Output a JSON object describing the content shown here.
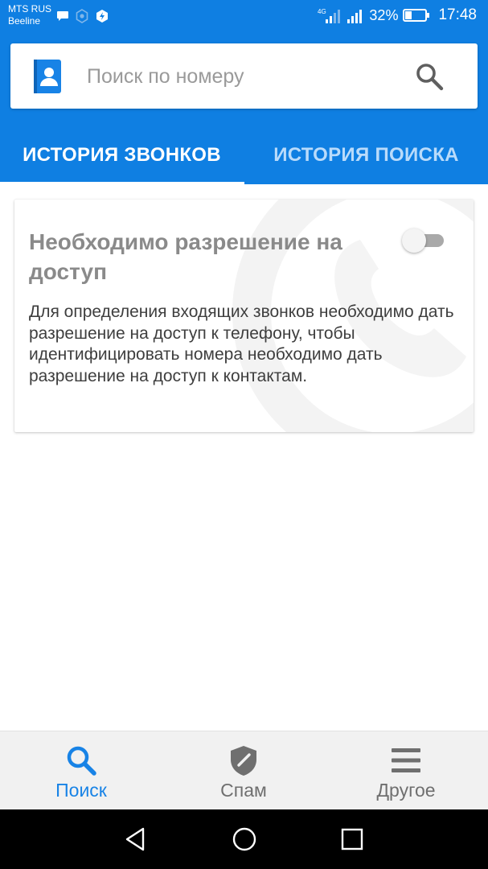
{
  "status_bar": {
    "carrier_line1": "MTS RUS",
    "carrier_line2": "Beeline",
    "network_type": "4G",
    "battery_percent": "32%",
    "time": "17:48"
  },
  "search": {
    "placeholder": "Поиск по номеру",
    "value": ""
  },
  "tabs": [
    {
      "label": "ИСТОРИЯ ЗВОНКОВ",
      "active": true
    },
    {
      "label": "ИСТОРИЯ ПОИСКА",
      "active": false
    }
  ],
  "permission_card": {
    "title": "Необходимо разрешение на доступ",
    "text": "Для определения входящих звонков необходимо дать разрешение на доступ к телефону, чтобы идентифицировать номера необходимо дать разрешение на доступ к контактам.",
    "toggle_on": false
  },
  "bottom_nav": [
    {
      "label": "Поиск",
      "icon": "search-icon",
      "active": true
    },
    {
      "label": "Спам",
      "icon": "shield-icon",
      "active": false
    },
    {
      "label": "Другое",
      "icon": "menu-icon",
      "active": false
    }
  ],
  "colors": {
    "primary": "#0f7fe2",
    "accent_active": "#1883e6",
    "inactive_tab": "#b9dbfb",
    "nav_inactive": "#6f6f6f"
  }
}
